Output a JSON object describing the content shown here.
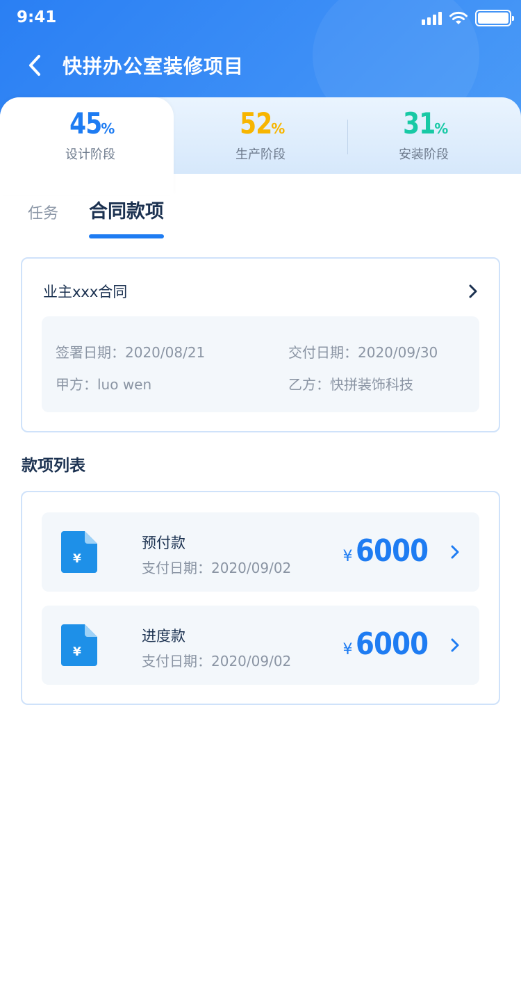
{
  "status_bar": {
    "time": "9:41",
    "icons": [
      "signal-icon",
      "wifi-icon",
      "battery-icon"
    ]
  },
  "nav": {
    "back_icon": "chevron-left-icon",
    "title": "快拼办公室装修项目"
  },
  "stages": [
    {
      "value": "45",
      "unit": "%",
      "label": "设计阶段",
      "color": "#1e7cf2",
      "active": true
    },
    {
      "value": "52",
      "unit": "%",
      "label": "生产阶段",
      "color": "#f7b500",
      "active": false
    },
    {
      "value": "31",
      "unit": "%",
      "label": "安装阶段",
      "color": "#18c9a5",
      "active": false
    }
  ],
  "tabs": [
    {
      "label": "任务",
      "active": false
    },
    {
      "label": "合同款项",
      "active": true
    }
  ],
  "contract": {
    "title": "业主xxx合同",
    "sign_date": "签署日期：2020/08/21",
    "delivery_date": "交付日期：2020/09/30",
    "party_a": "甲方：luo wen",
    "party_b": "乙方：快拼装饰科技"
  },
  "payments": {
    "section_title": "款项列表",
    "items": [
      {
        "name": "预付款",
        "date": "支付日期：2020/09/02",
        "currency": "¥",
        "amount": "6000",
        "icon": "document-yuan-icon"
      },
      {
        "name": "进度款",
        "date": "支付日期：2020/09/02",
        "currency": "¥",
        "amount": "6000",
        "icon": "document-yuan-icon"
      }
    ]
  },
  "colors": {
    "accent": "#1e7cf2",
    "header": "#2a7ff3",
    "card_border": "#cfe2fa",
    "panel_bg": "#f3f7fb"
  }
}
